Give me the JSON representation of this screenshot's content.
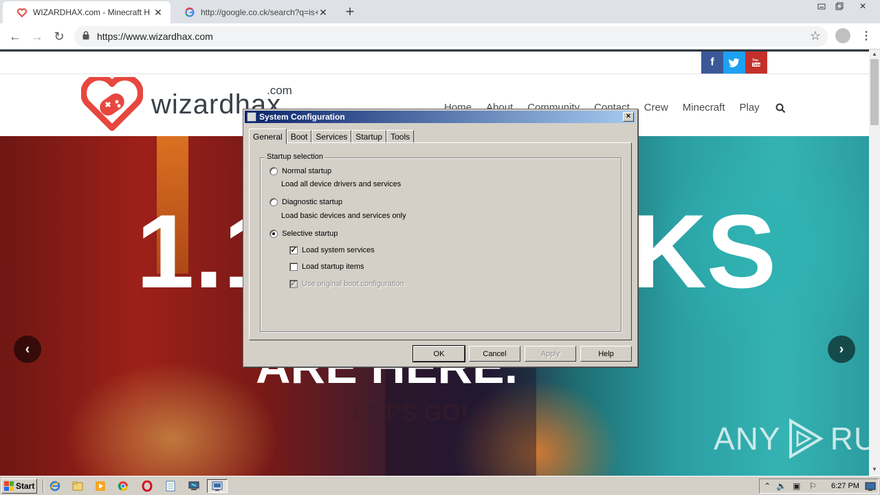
{
  "browser": {
    "tabs": [
      {
        "title": "WIZARDHAX.com - Minecraft Hacks,",
        "favicon": "heart-gamepad-icon",
        "active": true
      },
      {
        "title": "http://google.co.ck/search?q=is+illu",
        "favicon": "google-g-icon",
        "active": false
      }
    ],
    "url": "https://www.wizardhax.com"
  },
  "site": {
    "logo_text": "wizardhax",
    "logo_suffix": ".com",
    "social": [
      "f",
      "t",
      "yt"
    ],
    "nav": [
      "Home",
      "About",
      "Community",
      "Contact",
      "Crew",
      "Minecraft",
      "Play"
    ],
    "hero": {
      "title_left": "1.1",
      "title_right": "KS",
      "subtitle": "ARE HERE.",
      "cta": "LET'S GO!"
    },
    "watermark": {
      "left": "ANY",
      "right": "RUN"
    }
  },
  "dialog": {
    "title": "System Configuration",
    "tabs": [
      "General",
      "Boot",
      "Services",
      "Startup",
      "Tools"
    ],
    "selected_tab": "General",
    "group_label": "Startup selection",
    "options": [
      {
        "label": "Normal startup",
        "description": "Load all device drivers and services",
        "selected": false
      },
      {
        "label": "Diagnostic startup",
        "description": "Load basic devices and services only",
        "selected": false
      },
      {
        "label": "Selective startup",
        "selected": true
      }
    ],
    "checks": [
      {
        "label": "Load system services",
        "checked": true,
        "enabled": true
      },
      {
        "label": "Load startup items",
        "checked": false,
        "enabled": true
      },
      {
        "label": "Use original boot configuration",
        "checked": true,
        "enabled": false
      }
    ],
    "buttons": {
      "ok": "OK",
      "cancel": "Cancel",
      "apply": "Apply",
      "help": "Help"
    }
  },
  "taskbar": {
    "start_label": "Start",
    "clock": "6:27 PM"
  },
  "colors": {
    "dialog_bg": "#d4d0c8",
    "titlebar_from": "#0a246a",
    "titlebar_to": "#a6caf0",
    "logo_red": "#e8473f",
    "facebook": "#3b5998",
    "twitter": "#1da1f2",
    "youtube": "#c4302b"
  }
}
